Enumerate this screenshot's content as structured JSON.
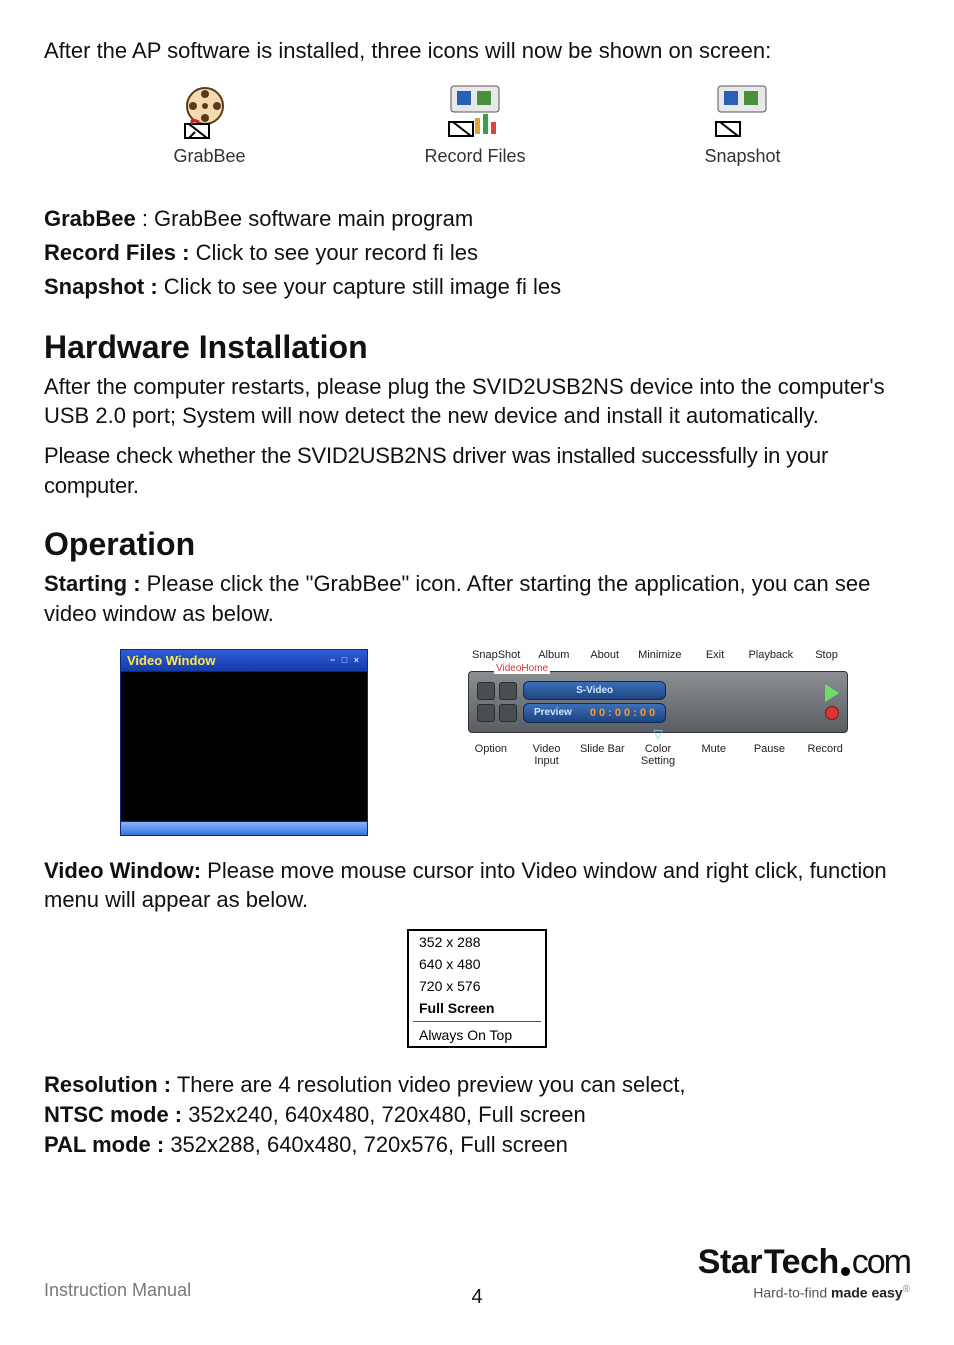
{
  "intro": "After the AP software is installed, three icons will now be shown on screen:",
  "icons": {
    "grabbee_caption": "GrabBee",
    "recordfiles_caption": "Record Files",
    "snapshot_caption": "Snapshot"
  },
  "definitions": {
    "grabbee_label": "GrabBee",
    "grabbee_text": " : GrabBee software main program",
    "record_label": "Record Files :",
    "record_text": " Click to see your record fi les",
    "snapshot_label": "Snapshot :",
    "snapshot_text": " Click to see your capture still image fi les"
  },
  "sections": {
    "hardware_title": "Hardware Installation",
    "hardware_p1": "After the computer restarts, please plug the SVID2USB2NS device into the computer's USB 2.0 port; System will now detect the new device and install it automatically.",
    "hardware_p2": "Please check whether the SVID2USB2NS driver was installed successfully in your computer.",
    "operation_title": "Operation",
    "starting_label": "Starting :",
    "starting_text": " Please click the \"GrabBee\" icon. After starting the application, you can see video window as below.",
    "vw_label": "Video Window:",
    "vw_text": " Please move mouse cursor into Video window and right click, function menu will appear as below.",
    "res_label": "Resolution :",
    "res_text": " There are 4 resolution video preview you can select,",
    "ntsc_label": "NTSC mode :",
    "ntsc_text": " 352x240, 640x480, 720x480, Full screen",
    "pal_label": "PAL mode :",
    "pal_text": " 352x288, 640x480, 720x576, Full screen"
  },
  "video_window": {
    "title": "Video Window",
    "ctrls": "− □ ×"
  },
  "control_panel": {
    "top_labels": [
      "SnapShot",
      "Album",
      "About",
      "Minimize",
      "Exit",
      "Playback",
      "Stop"
    ],
    "brand_tag": "VideoHome",
    "pill1": "S-Video",
    "pill2": "Preview",
    "time": "0 0 : 0 0 : 0 0",
    "bot_labels": [
      "Option",
      "Video Input",
      "Slide Bar",
      "Color Setting",
      "Mute",
      "Pause",
      "Record"
    ]
  },
  "context_menu": {
    "items": [
      "352 x 288",
      "640 x 480",
      "720 x 576",
      "Full Screen",
      "Always On Top"
    ]
  },
  "footer": {
    "left": "Instruction Manual",
    "page": "4",
    "brand_a": "Star",
    "brand_b": "Tech",
    "brand_c": "com",
    "tag_a": "Hard-to-find ",
    "tag_b": "made easy",
    "reg": "®"
  }
}
